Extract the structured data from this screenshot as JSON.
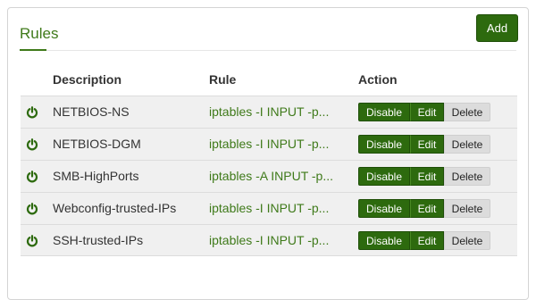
{
  "panel": {
    "title": "Rules",
    "add_label": "Add"
  },
  "table": {
    "headers": {
      "description": "Description",
      "rule": "Rule",
      "action": "Action"
    },
    "rows": [
      {
        "description": "NETBIOS-NS",
        "rule": "iptables -I INPUT -p...",
        "enabled": true
      },
      {
        "description": "NETBIOS-DGM",
        "rule": "iptables -I INPUT -p...",
        "enabled": true
      },
      {
        "description": "SMB-HighPorts",
        "rule": "iptables -A INPUT -p...",
        "enabled": true
      },
      {
        "description": "Webconfig-trusted-IPs",
        "rule": "iptables -I INPUT -p...",
        "enabled": true
      },
      {
        "description": "SSH-trusted-IPs",
        "rule": "iptables -I INPUT -p...",
        "enabled": true
      }
    ],
    "actions": {
      "disable": "Disable",
      "edit": "Edit",
      "delete": "Delete"
    }
  },
  "colors": {
    "accent": "#3f7a1a",
    "button": "#2d6a0e",
    "row_bg": "#f0f0f0"
  },
  "icons": {
    "status": "power-icon"
  }
}
